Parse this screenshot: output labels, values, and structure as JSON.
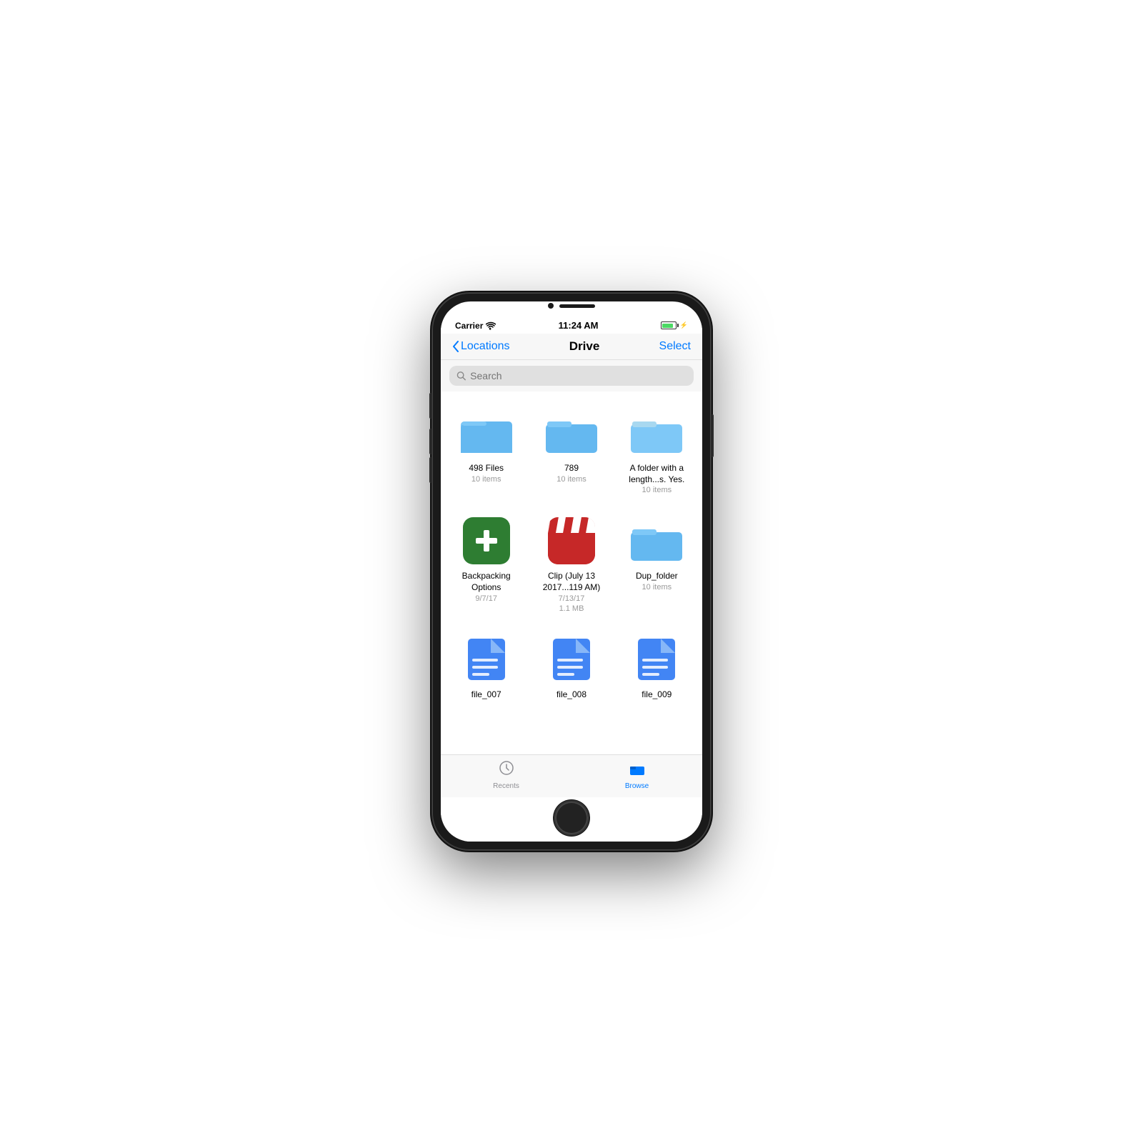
{
  "status_bar": {
    "carrier": "Carrier",
    "time": "11:24 AM"
  },
  "nav": {
    "back_label": "Locations",
    "title": "Drive",
    "select_label": "Select"
  },
  "search": {
    "placeholder": "Search"
  },
  "grid_items": [
    {
      "id": "folder-498",
      "type": "folder",
      "name": "498 Files",
      "meta": "10 items"
    },
    {
      "id": "folder-789",
      "type": "folder",
      "name": "789",
      "meta": "10 items"
    },
    {
      "id": "folder-long",
      "type": "folder",
      "name": "A folder with a length...s. Yes.",
      "meta": "10 items"
    },
    {
      "id": "backpacking",
      "type": "app-green-cross",
      "name": "Backpacking Options",
      "meta": "9/7/17"
    },
    {
      "id": "clip",
      "type": "app-clip",
      "name": "Clip (July 13 2017...119 AM)",
      "meta_line1": "7/13/17",
      "meta_line2": "1.1 MB"
    },
    {
      "id": "dup-folder",
      "type": "folder",
      "name": "Dup_folder",
      "meta": "10 items"
    },
    {
      "id": "file-007",
      "type": "doc",
      "name": "file_007",
      "meta": ""
    },
    {
      "id": "file-008",
      "type": "doc",
      "name": "file_008",
      "meta": ""
    },
    {
      "id": "file-009",
      "type": "doc",
      "name": "file_009",
      "meta": ""
    }
  ],
  "tab_bar": {
    "recents_label": "Recents",
    "browse_label": "Browse",
    "active_tab": "browse"
  }
}
